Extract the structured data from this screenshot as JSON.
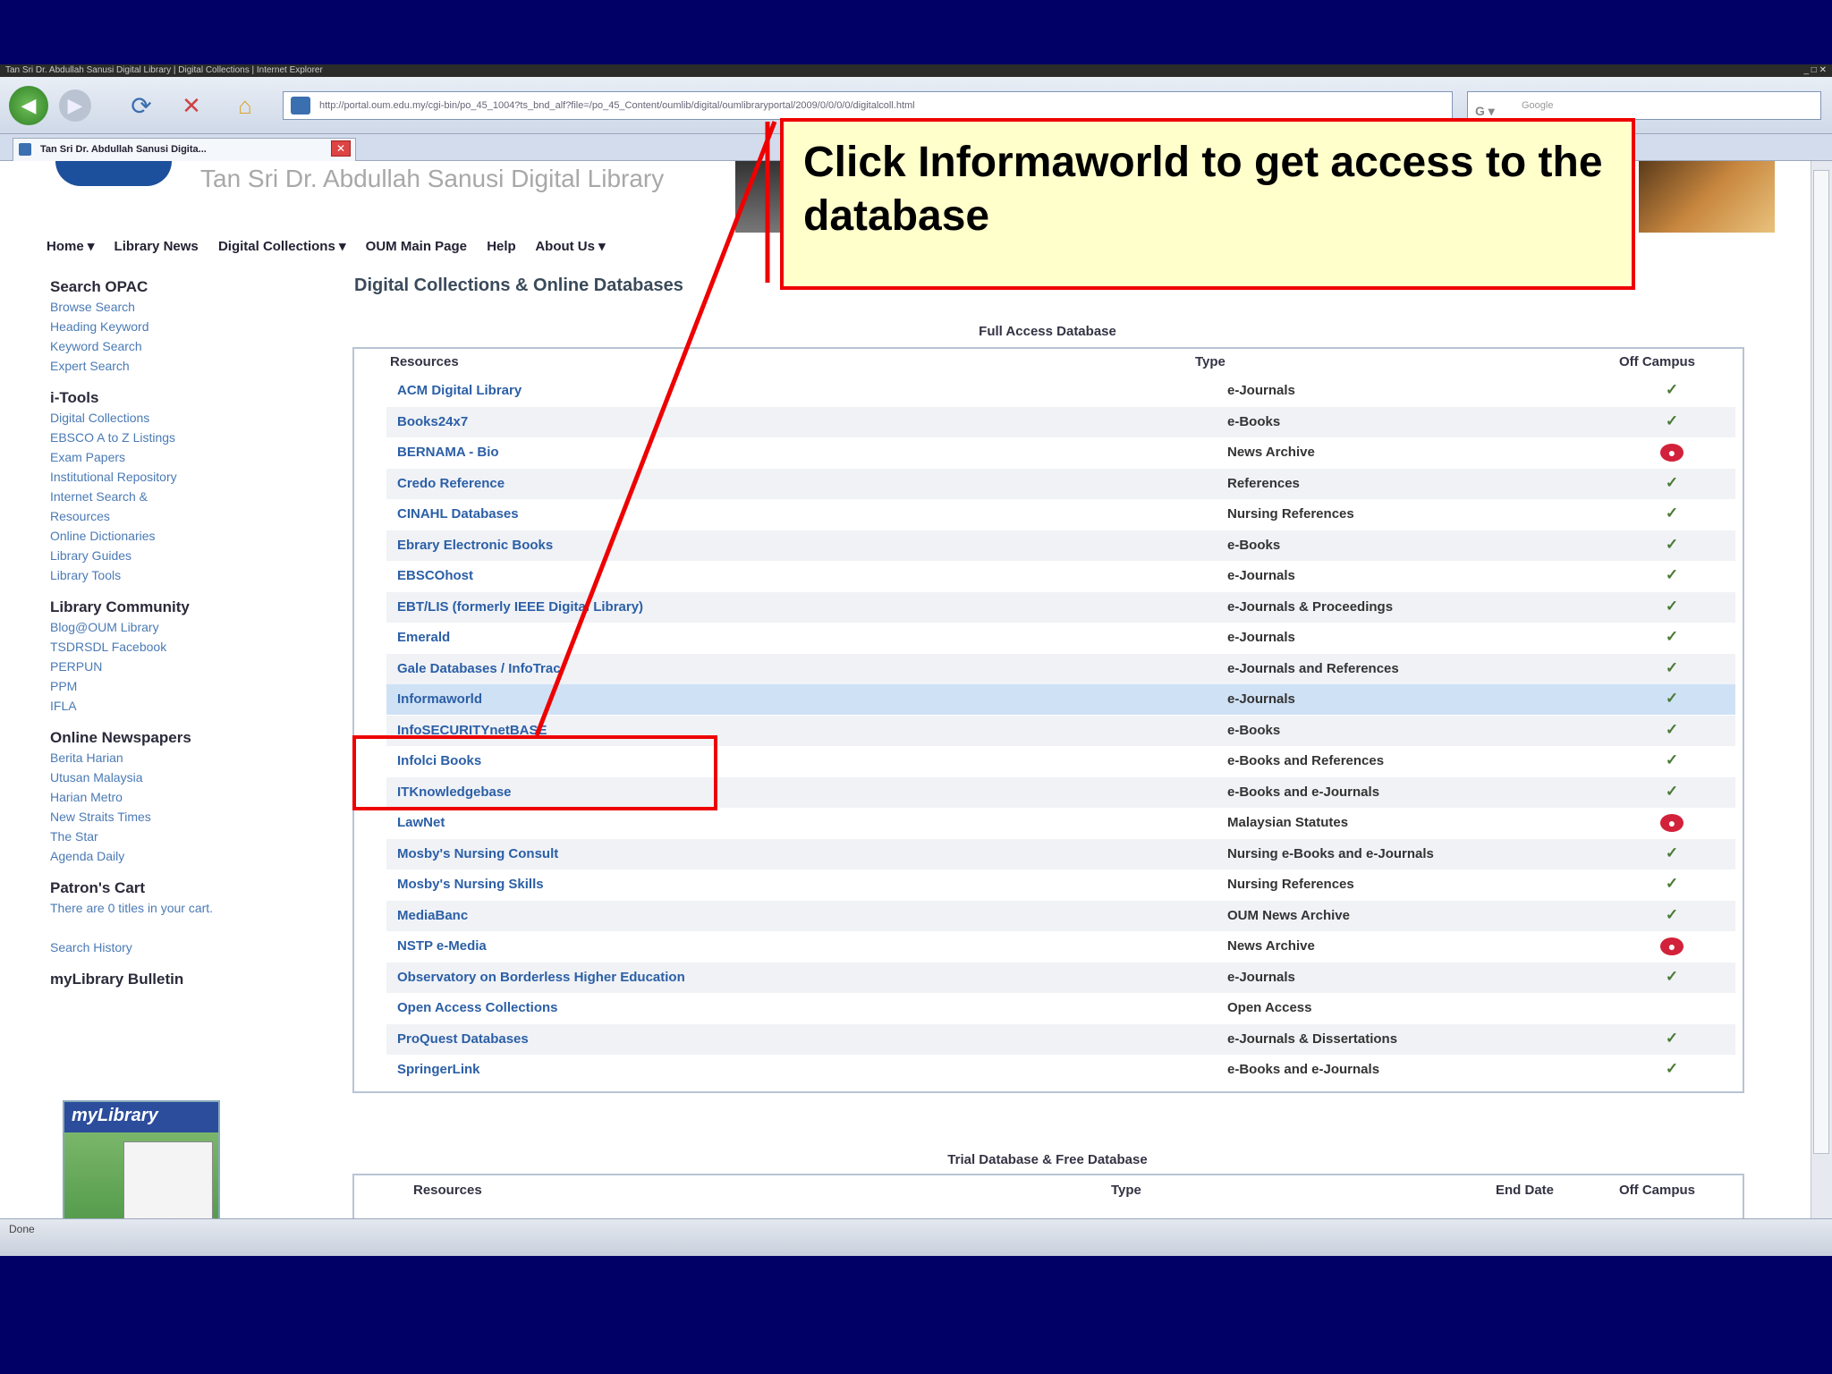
{
  "window": {
    "title_text": "Tan Sri Dr. Abdullah Sanusi Digital Library | Digital Collections | Internet Explorer",
    "url": "http://portal.oum.edu.my/cgi-bin/po_45_1004?ts_bnd_alf?file=/po_45_Content/oumlib/digital/oumlibraryportal/2009/0/0/0/0/digitalcoll.html",
    "search_placeholder": "Google",
    "tab_label": "Tan Sri Dr. Abdullah Sanusi Digita...",
    "status_text": "Done"
  },
  "site": {
    "title": "Tan Sri Dr. Abdullah Sanusi Digital Library",
    "menu": [
      "Home ▾",
      "Library News",
      "Digital Collections ▾",
      "OUM Main Page",
      "Help",
      "About Us ▾"
    ]
  },
  "sidebar": {
    "sections": [
      {
        "heading": "Search OPAC",
        "links": [
          "Browse Search",
          "Heading Keyword",
          "Keyword Search",
          "Expert Search"
        ]
      },
      {
        "heading": "i-Tools",
        "links": [
          "Digital Collections",
          "EBSCO A to Z Listings",
          "Exam Papers",
          "Institutional Repository",
          "Internet Search &",
          "Resources",
          "Online Dictionaries",
          "Library Guides",
          "Library Tools"
        ]
      },
      {
        "heading": "Library Community",
        "links": [
          "Blog@OUM Library",
          "TSDRSDL Facebook",
          "PERPUN",
          "PPM",
          "IFLA"
        ]
      },
      {
        "heading": "Online Newspapers",
        "links": [
          "Berita Harian",
          "Utusan Malaysia",
          "Harian Metro",
          "New Straits Times",
          "The Star",
          "Agenda Daily"
        ]
      },
      {
        "heading": "Patron's Cart",
        "links": [
          "There are 0 titles in your cart.",
          "",
          "Search History"
        ]
      },
      {
        "heading": "myLibrary Bulletin",
        "links": []
      }
    ],
    "bulletin_label": "myLibrary"
  },
  "main": {
    "title": "Digital Collections & Online Databases",
    "full_access_caption": "Full Access Database",
    "columns": {
      "resources": "Resources",
      "type": "Type",
      "off_campus": "Off Campus"
    },
    "rows": [
      {
        "resource": "ACM Digital Library",
        "type": "e-Journals",
        "off": "✓",
        "ok": true
      },
      {
        "resource": "Books24x7",
        "type": "e-Books",
        "off": "✓",
        "ok": true
      },
      {
        "resource": "BERNAMA - Bio",
        "type": "News Archive",
        "off": "●",
        "ok": false
      },
      {
        "resource": "Credo Reference",
        "type": "References",
        "off": "✓",
        "ok": true
      },
      {
        "resource": "CINAHL Databases",
        "type": "Nursing References",
        "off": "✓",
        "ok": true
      },
      {
        "resource": "Ebrary Electronic Books",
        "type": "e-Books",
        "off": "✓",
        "ok": true
      },
      {
        "resource": "EBSCOhost",
        "type": "e-Journals",
        "off": "✓",
        "ok": true
      },
      {
        "resource": "EBT/LIS (formerly IEEE Digital Library)",
        "type": "e-Journals & Proceedings",
        "off": "✓",
        "ok": true
      },
      {
        "resource": "Emerald",
        "type": "e-Journals",
        "off": "✓",
        "ok": true
      },
      {
        "resource": "Gale Databases / InfoTrac",
        "type": "e-Journals and References",
        "off": "✓",
        "ok": true
      },
      {
        "resource": "Informaworld",
        "type": "e-Journals",
        "off": "✓",
        "ok": true
      },
      {
        "resource": "InfoSECURITYnetBASE",
        "type": "e-Books",
        "off": "✓",
        "ok": true
      },
      {
        "resource": "Infolci Books",
        "type": "e-Books and References",
        "off": "✓",
        "ok": true
      },
      {
        "resource": "ITKnowledgebase",
        "type": "e-Books and e-Journals",
        "off": "✓",
        "ok": true
      },
      {
        "resource": "LawNet",
        "type": "Malaysian Statutes",
        "off": "●",
        "ok": false
      },
      {
        "resource": "Mosby's Nursing Consult",
        "type": "Nursing e-Books and e-Journals",
        "off": "✓",
        "ok": true
      },
      {
        "resource": "Mosby's Nursing Skills",
        "type": "Nursing References",
        "off": "✓",
        "ok": true
      },
      {
        "resource": "MediaBanc",
        "type": "OUM News Archive",
        "off": "✓",
        "ok": true
      },
      {
        "resource": "NSTP e-Media",
        "type": "News Archive",
        "off": "●",
        "ok": false
      },
      {
        "resource": "Observatory on Borderless Higher Education",
        "type": "e-Journals",
        "off": "✓",
        "ok": true
      },
      {
        "resource": "Open Access Collections",
        "type": "Open Access",
        "off": "",
        "ok": true
      },
      {
        "resource": "ProQuest Databases",
        "type": "e-Journals & Dissertations",
        "off": "✓",
        "ok": true
      },
      {
        "resource": "SpringerLink",
        "type": "e-Books and e-Journals",
        "off": "✓",
        "ok": true
      }
    ],
    "trial_caption": "Trial Database & Free Database",
    "trial_columns": {
      "resources": "Resources",
      "type": "Type",
      "end_date": "End Date",
      "off_campus": "Off Campus"
    }
  },
  "annotation": {
    "callout_text": "Click Informaworld to get access to the database",
    "color": "#ee0000"
  }
}
